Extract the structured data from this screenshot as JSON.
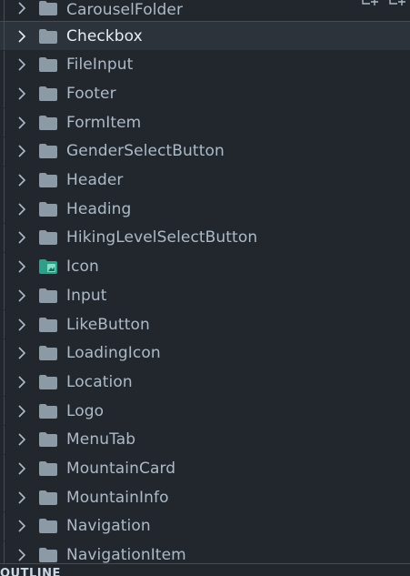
{
  "explorer": {
    "partial_top_label": "CarouselFolder",
    "items": [
      {
        "label": "Checkbox",
        "icon": "folder-icon",
        "selected": true
      },
      {
        "label": "FileInput",
        "icon": "folder-icon"
      },
      {
        "label": "Footer",
        "icon": "folder-icon"
      },
      {
        "label": "FormItem",
        "icon": "folder-icon"
      },
      {
        "label": "GenderSelectButton",
        "icon": "folder-icon"
      },
      {
        "label": "Header",
        "icon": "folder-icon"
      },
      {
        "label": "Heading",
        "icon": "folder-icon"
      },
      {
        "label": "HikingLevelSelectButton",
        "icon": "folder-icon"
      },
      {
        "label": "Icon",
        "icon": "folder-image-icon"
      },
      {
        "label": "Input",
        "icon": "folder-icon"
      },
      {
        "label": "LikeButton",
        "icon": "folder-icon"
      },
      {
        "label": "LoadingIcon",
        "icon": "folder-icon"
      },
      {
        "label": "Location",
        "icon": "folder-icon"
      },
      {
        "label": "Logo",
        "icon": "folder-icon"
      },
      {
        "label": "MenuTab",
        "icon": "folder-icon"
      },
      {
        "label": "MountainCard",
        "icon": "folder-icon"
      },
      {
        "label": "MountainInfo",
        "icon": "folder-icon"
      },
      {
        "label": "Navigation",
        "icon": "folder-icon"
      },
      {
        "label": "NavigationItem",
        "icon": "folder-icon"
      }
    ]
  },
  "outline": {
    "title": "OUTLINE"
  },
  "colors": {
    "background": "#22272e",
    "selected_row": "#2d333b",
    "folder": "#8b9aa5",
    "icon_folder": "#2ea08a",
    "text": "#adbac7"
  }
}
